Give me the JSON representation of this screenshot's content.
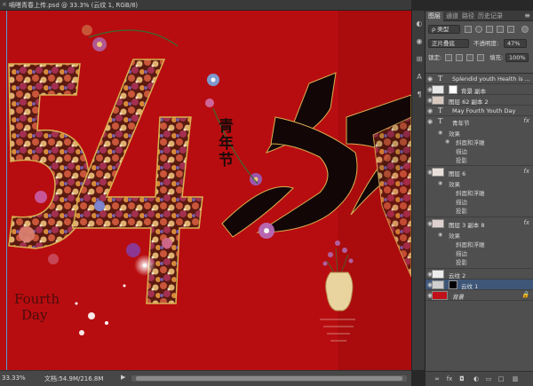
{
  "document": {
    "tab_title": "嘀嗒青春上传.psd @ 33.3% (云纹 1, RGB/8)",
    "close_glyph": "×"
  },
  "canvas": {
    "title_cn": "青年节",
    "big_number": "54",
    "big_char": "青",
    "text_fourth": "Fourth",
    "text_day": "Day",
    "background_color": "#b80d10",
    "guide_color": "#35c0ff"
  },
  "status": {
    "zoom": "33.33%",
    "doc_size": "文档:54.9M/216.8M",
    "arrow": "▶"
  },
  "panel": {
    "tabs": [
      "图层",
      "通道",
      "路径",
      "历史记录"
    ],
    "menu_icon": "≡",
    "filter_kind": "ρ 类型",
    "blend_mode": "正片叠底",
    "opacity_label": "不透明度:",
    "opacity_value": "47%",
    "lock_label": "锁定:",
    "fill_label": "填充:",
    "fill_value": "100%",
    "layers": [
      {
        "type": "text",
        "name": "Splendid youth Health is ..."
      },
      {
        "type": "image",
        "name": "背景 副本"
      },
      {
        "type": "image",
        "name": "图层 62 副本 2"
      },
      {
        "type": "text",
        "name": "May Fourth Youth Day"
      },
      {
        "type": "text",
        "name": "青年节",
        "fx": "fx",
        "effects_label": "效果",
        "effects": [
          "斜面和浮雕",
          "描边",
          "投影"
        ]
      },
      {
        "type": "image",
        "name": "图层 6",
        "fx": "fx",
        "effects_label": "效果",
        "effects": [
          "斜面和浮雕",
          "描边",
          "投影"
        ]
      },
      {
        "type": "image",
        "name": "图层 3 副本 8",
        "fx": "fx",
        "effects_label": "效果",
        "effects": [
          "斜面和浮雕",
          "描边",
          "投影"
        ]
      },
      {
        "type": "image",
        "name": "云纹 2"
      },
      {
        "type": "image",
        "name": "云纹 1",
        "selected": true
      },
      {
        "type": "fill",
        "name": "背景",
        "italic": true
      }
    ]
  },
  "colors": {
    "panel_bg": "#535353",
    "selected_row": "#3e5778",
    "swatch_red": "#c0111a"
  }
}
